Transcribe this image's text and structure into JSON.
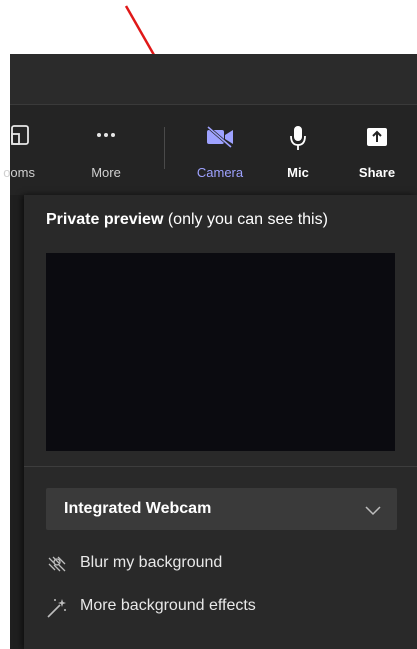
{
  "toolbar": {
    "rooms_label": "ooms",
    "more_label": "More",
    "camera_label": "Camera",
    "mic_label": "Mic",
    "share_label": "Share"
  },
  "preview": {
    "title_bold": "Private preview",
    "title_rest": " (only you can see this)"
  },
  "camera_select": {
    "value": "Integrated Webcam"
  },
  "effects": {
    "blur_label": "Blur my background",
    "more_effects_label": "More background effects"
  },
  "colors": {
    "accent": "#9ea2ff",
    "annotation_arrow": "#e01818"
  },
  "icons": [
    "rooms-icon",
    "more-dots-icon",
    "camera-off-icon",
    "mic-icon",
    "share-icon",
    "chevron-down-icon",
    "blur-icon",
    "magic-wand-icon"
  ]
}
